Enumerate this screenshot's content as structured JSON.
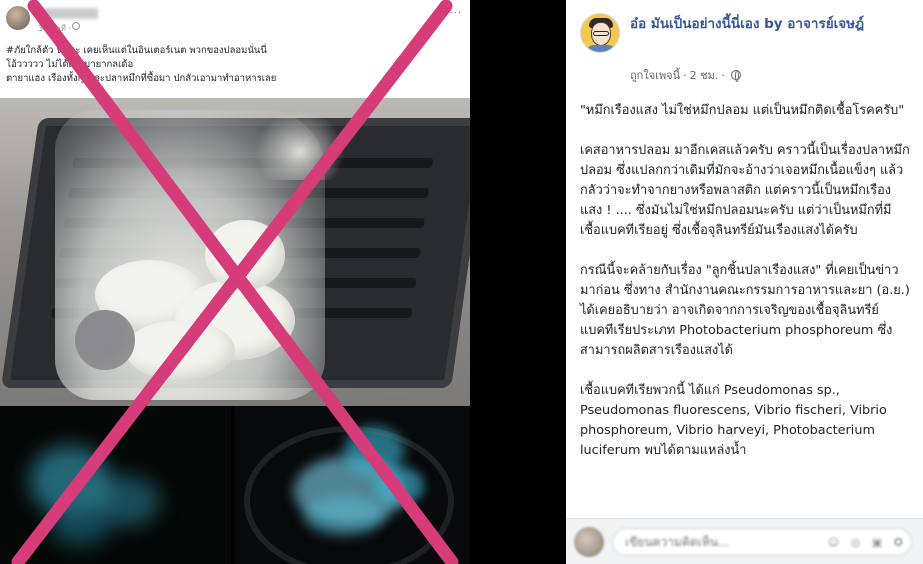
{
  "original_post": {
    "author_name": "",
    "time": "30 นาที ·",
    "more": "···",
    "lines": [
      "#ภัยใกล้ตัว   นี่สินะ เคยเห็นแต่ในอินเตอร์เนต พวกของปลอมนั่นนี่",
      "โอ้ววววว ไม่ได้เล่นมายากลเด้อ",
      "ตายาแฮง เรืองทั้งกุ้งและปลาหมึกที่ซื้อมา ปกลัวเอามาทำอาหารเลย"
    ]
  },
  "page": {
    "name": "อ๋อ มันเป็นอย่างนี้นี่เอง by อาจารย์เจษฎ์",
    "liked_by": "ถูกใจเพจนี้",
    "time": "2 ชม."
  },
  "post": {
    "paragraphs": [
      "\"หมึกเรืองแสง ไม่ใช่หมึกปลอม แต่เป็นหมึกติดเชื้อโรคครับ\"",
      "เคสอาหารปลอม มาอีกเคสแล้วครับ คราวนี้เป็นเรื่องปลาหมึกปลอม ซึ่งแปลกกว่าเดิมที่มักจะอ้างว่าเจอหมึกเนื้อแข็งๆ แล้วกลัวว่าจะทำจากยางหรือพลาสติก แต่คราวนี้เป็นหมึกเรืองแสง ! .... ซึ่งมันไม่ใช่หมึกปลอมนะครับ แต่ว่าเป็นหมึกที่มีเชื้อแบคทีเรียอยู่ ซึ่งเชื้อจุลินทรีย์มันเรืองแสงได้ครับ",
      "กรณีนี้จะคล้ายกับเรื่อง \"ลูกชิ้นปลาเรืองแสง\" ที่เคยเป็นข่าวมาก่อน ซึ่งทาง สำนักงานคณะกรรมการอาหารและยา (อ.ย.) ได้เคยอธิบายว่า อาจเกิดจากการเจริญของเชื้อจุลินทรีย์แบคทีเรียประเภท Photobacterium phosphoreum ซึ่งสามารถผลิตสารเรืองแสงได้",
      "เชื้อแบคทีเรียพวกนี้ ได้แก่ Pseudomonas sp., Pseudomonas fluorescens, Vibrio fischeri, Vibrio phosphoreum, Vibrio harveyi, Photobacterium luciferum พบได้ตามแหล่งน้ำ"
    ]
  },
  "comment": {
    "placeholder": "เขียนความคิดเห็น...",
    "icons": "☺ ◎ ▣ ✪"
  },
  "colors": {
    "x_mark": "#d63b7a",
    "page_name": "#385898",
    "glow": "#3fb7d6"
  }
}
